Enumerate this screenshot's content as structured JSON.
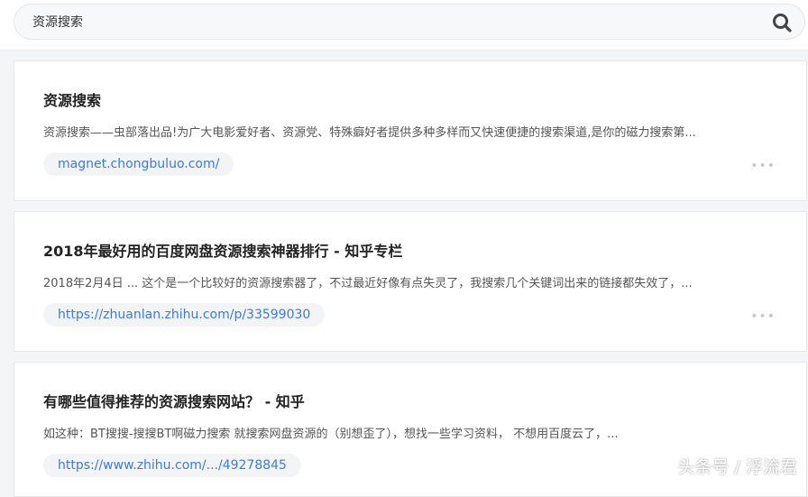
{
  "search": {
    "value": "资源搜索"
  },
  "results": [
    {
      "title": "资源搜索",
      "snippet": "资源搜索——虫部落出品!为广大电影爱好者、资源党、特殊癖好者提供多种多样而又快速便捷的搜索渠道,是你的磁力搜索第...",
      "url": "magnet.chongbuluo.com/",
      "more": "•••"
    },
    {
      "title": "2018年最好用的百度网盘资源搜索神器排行 - 知乎专栏",
      "snippet": "2018年2月4日 ... 这个是一个比较好的资源搜索器了，不过最近好像有点失灵了，我搜索几个关键词出来的链接都失效了，...",
      "url": "https://zhuanlan.zhihu.com/p/33599030",
      "more": "•••"
    },
    {
      "title": "有哪些值得推荐的资源搜索网站？ - 知乎",
      "snippet": "如这种：BT搜搜-搜搜BT啊磁力搜索 就搜索网盘资源的（别想歪了），想找一些学习资料， 不想用百度云了，...",
      "url": "https://www.zhihu.com/.../49278845"
    }
  ],
  "watermark": "头条号 / 浮流君"
}
